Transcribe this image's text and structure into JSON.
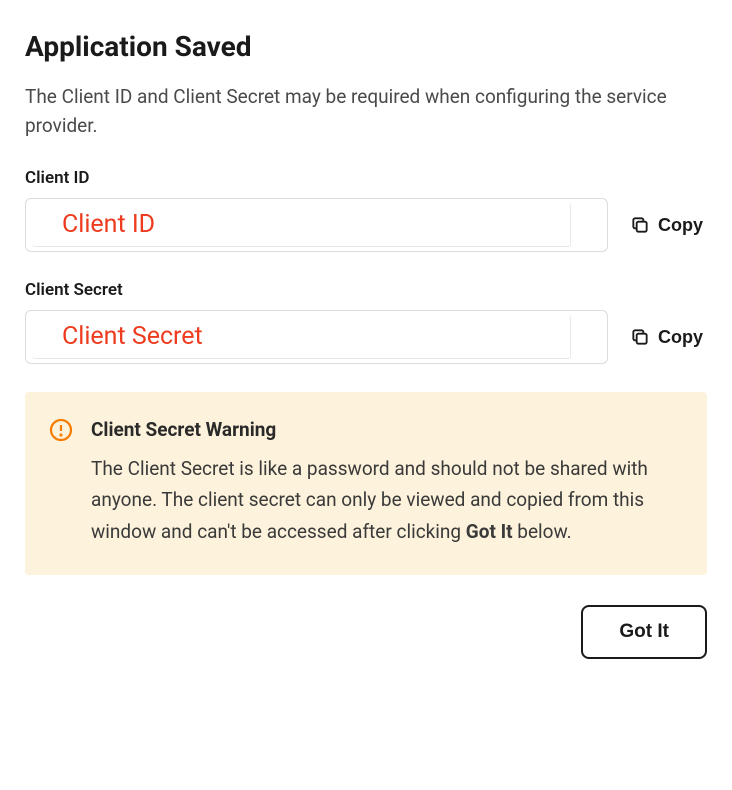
{
  "title": "Application Saved",
  "description": "The Client ID and Client Secret may be required when configuring the service provider.",
  "client_id": {
    "label": "Client ID",
    "placeholder": "Client ID",
    "copy_label": "Copy"
  },
  "client_secret": {
    "label": "Client Secret",
    "placeholder": "Client Secret",
    "copy_label": "Copy"
  },
  "warning": {
    "title": "Client Secret Warning",
    "text_part1": "The Client Secret is like a password and should not be shared with anyone. The client secret can only be viewed and copied from this window and can't be accessed after clicking ",
    "bold": "Got It",
    "text_part2": " below."
  },
  "got_it_label": "Got It"
}
